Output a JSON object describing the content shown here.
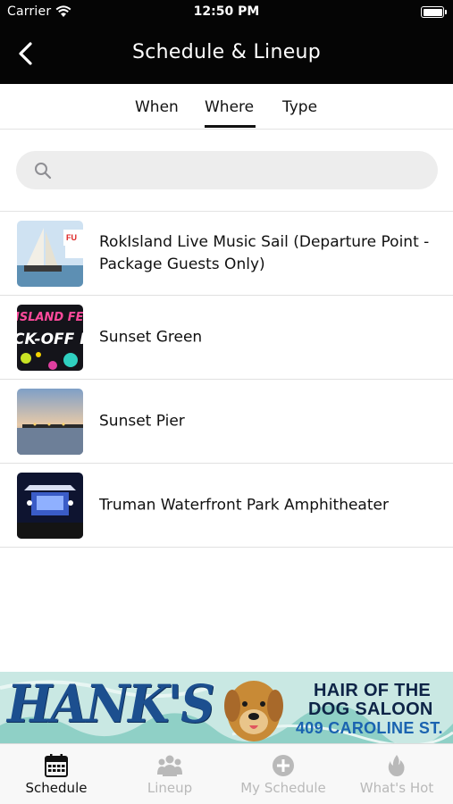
{
  "status_bar": {
    "carrier": "Carrier",
    "time": "12:50 PM"
  },
  "header": {
    "title": "Schedule & Lineup",
    "back_icon": "chevron-left-icon"
  },
  "tabs": [
    {
      "label": "When",
      "active": false
    },
    {
      "label": "Where",
      "active": true
    },
    {
      "label": "Type",
      "active": false
    }
  ],
  "search": {
    "placeholder": "",
    "value": "",
    "icon": "search-icon"
  },
  "venues": [
    {
      "label": "RokIsland Live Music Sail (Departure Point - Package Guests Only)",
      "thumb": "catamaran-photo"
    },
    {
      "label": "Sunset Green",
      "thumb": "kick-off-party-poster"
    },
    {
      "label": "Sunset Pier",
      "thumb": "pier-sunset-photo"
    },
    {
      "label": "Truman Waterfront Park Amphitheater",
      "thumb": "concert-stage-photo"
    }
  ],
  "banner_ad": {
    "brand": "HANK'S",
    "line1": "HAIR OF THE",
    "line2": "DOG SALOON",
    "line3": "409 CAROLINE ST."
  },
  "tabbar": [
    {
      "label": "Schedule",
      "icon": "calendar-icon",
      "active": true
    },
    {
      "label": "Lineup",
      "icon": "people-icon",
      "active": false
    },
    {
      "label": "My Schedule",
      "icon": "plus-circle-icon",
      "active": false
    },
    {
      "label": "What's Hot",
      "icon": "flame-icon",
      "active": false
    }
  ],
  "colors": {
    "header_bg": "#050505",
    "active": "#111111",
    "inactive": "#b9b9b9",
    "banner_blue": "#1c4f8f"
  }
}
